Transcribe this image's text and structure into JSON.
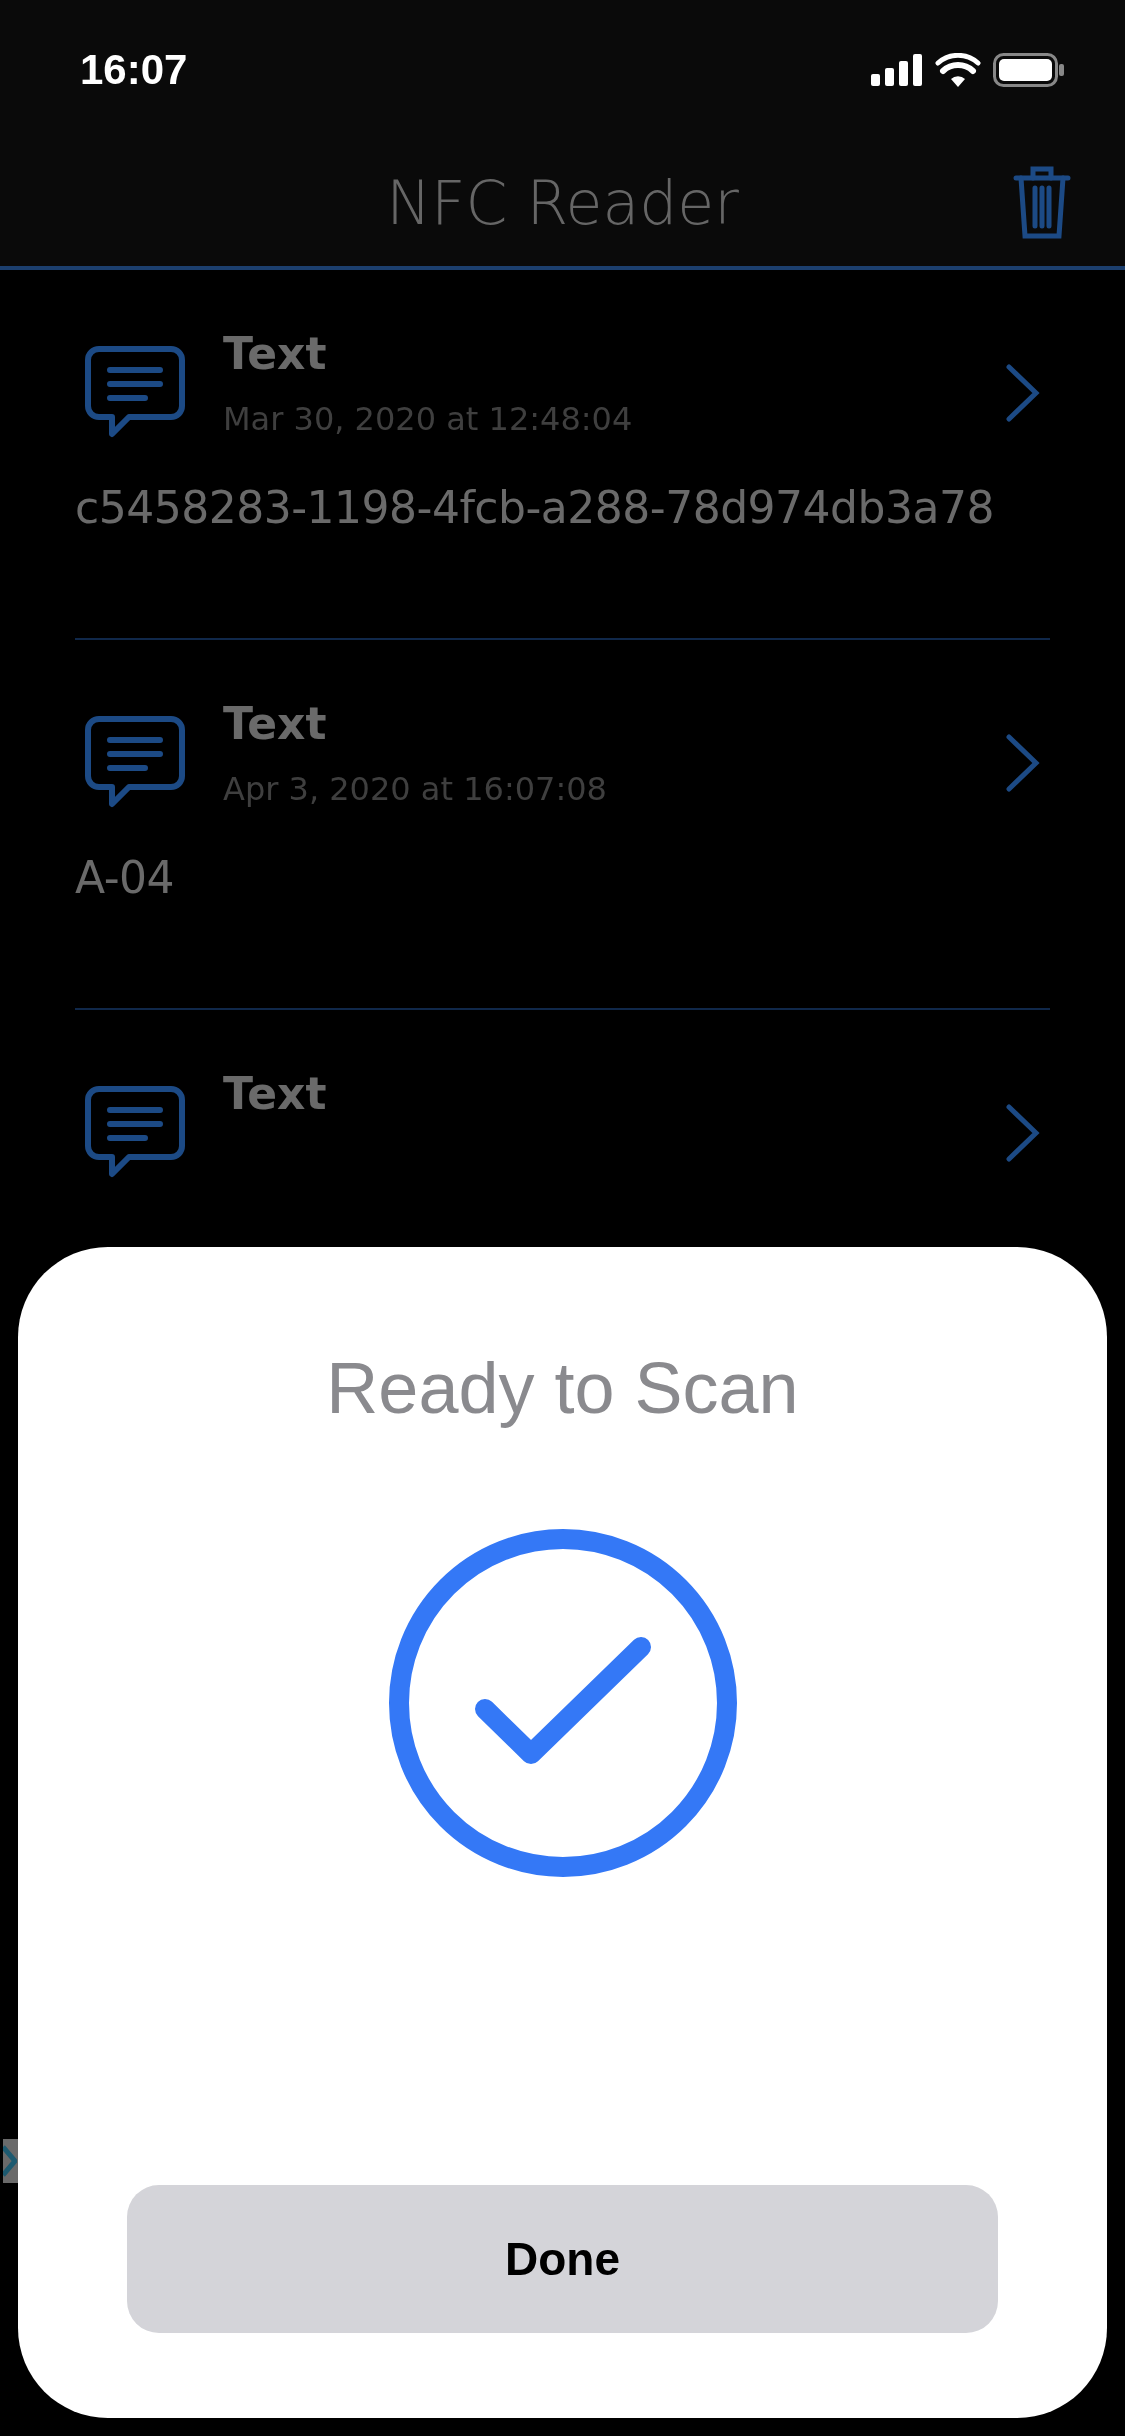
{
  "status_bar": {
    "time": "16:07"
  },
  "header": {
    "title": "NFC Reader"
  },
  "records": [
    {
      "type": "Text",
      "date": "Mar 30, 2020 at 12:48:04",
      "value": "c5458283-1198-4fcb-a288-78d974db3a78"
    },
    {
      "type": "Text",
      "date": "Apr 3, 2020 at 16:07:08",
      "value": "A-04"
    },
    {
      "type": "Text"
    }
  ],
  "scan_sheet": {
    "title": "Ready to Scan",
    "button": "Done"
  }
}
